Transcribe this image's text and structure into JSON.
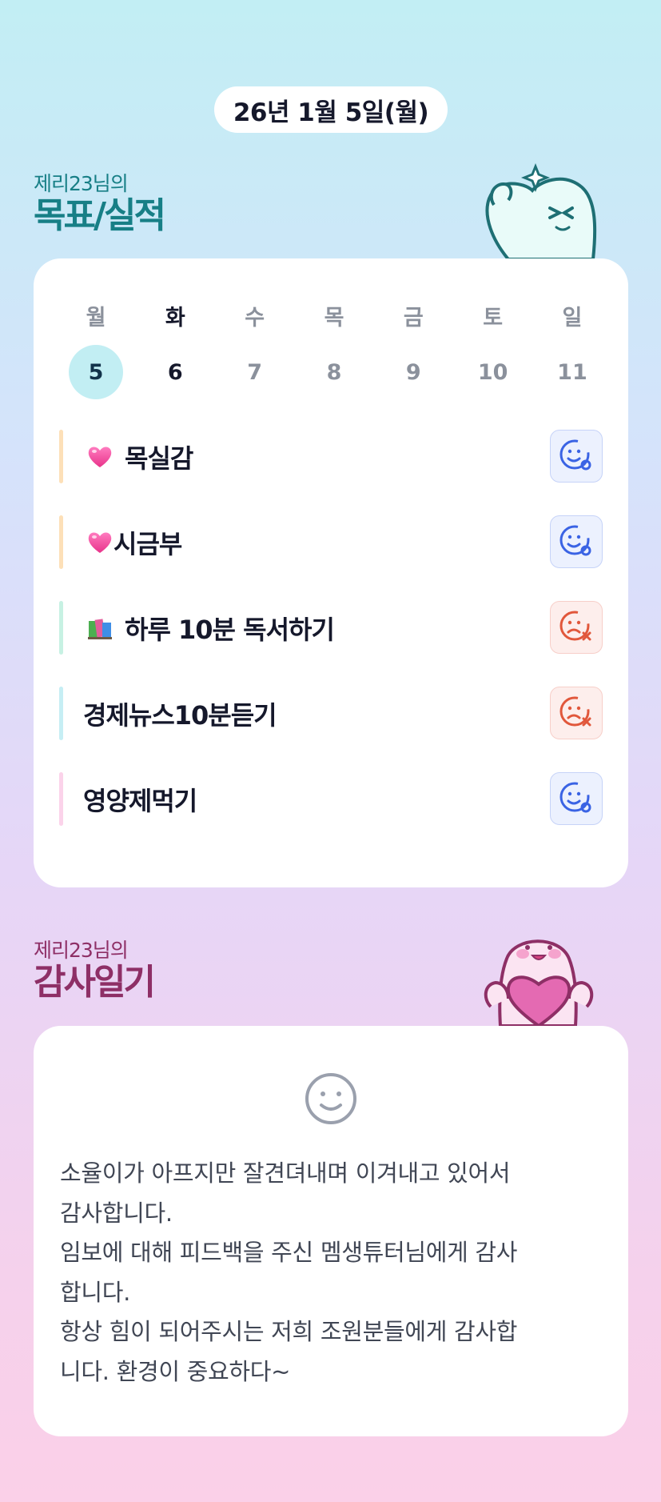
{
  "date": "26년 1월 5일(월)",
  "goals_section": {
    "subtitle": "제리23님의",
    "title": "목표/실적"
  },
  "week": {
    "days": [
      {
        "name": "월",
        "num": "5",
        "selected": true
      },
      {
        "name": "화",
        "num": "6",
        "today": true
      },
      {
        "name": "수",
        "num": "7"
      },
      {
        "name": "목",
        "num": "8"
      },
      {
        "name": "금",
        "num": "9"
      },
      {
        "name": "토",
        "num": "10"
      },
      {
        "name": "일",
        "num": "11"
      }
    ]
  },
  "goals": [
    {
      "label": "목실감",
      "icon": "heart-icon",
      "bar_color": "#fde0b8",
      "status": "done"
    },
    {
      "label": "시금부",
      "icon": "heart-icon",
      "bar_color": "#fde0b8",
      "status": "done"
    },
    {
      "label": "하루 10분 독서하기",
      "icon": "books-icon",
      "bar_color": "#c7f1e3",
      "status": "fail"
    },
    {
      "label": "경제뉴스10분듣기",
      "icon": "",
      "bar_color": "#c6eef4",
      "status": "fail"
    },
    {
      "label": "영양제먹기",
      "icon": "",
      "bar_color": "#fbd3ea",
      "status": "done"
    }
  ],
  "gratitude_section": {
    "subtitle": "제리23님의",
    "title": "감사일기",
    "mood_icon": "smiley-icon",
    "text": "소율이가 아프지만 잘견뎌내며 이겨내고 있어서\n감사합니다.\n임보에 대해 피드백을 주신 멤생튜터님에게 감사\n합니다.\n항상 힘이 되어주시는 저희 조원분들에게 감사합\n니다. 환경이 중요하다~"
  },
  "colors": {
    "done": "#3a63e4",
    "fail": "#e1573b",
    "goal_title": "#177f86",
    "gratitude_title": "#8e2f66"
  }
}
